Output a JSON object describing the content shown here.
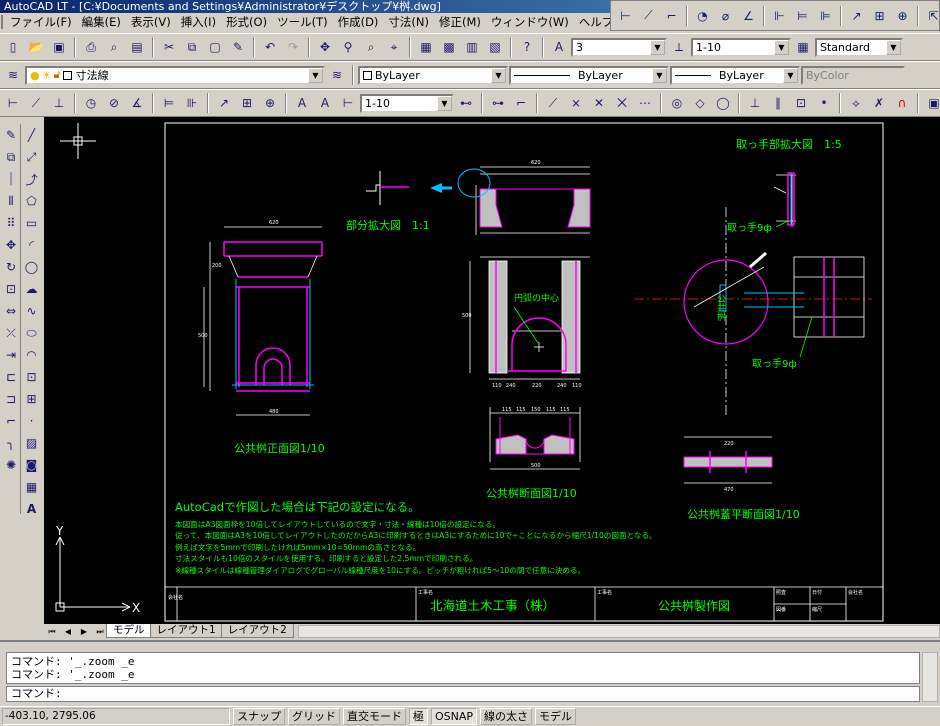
{
  "app": {
    "title": "AutoCAD LT - [C:¥Documents and Settings¥Administrator¥デスクトップ¥桝.dwg]"
  },
  "menu": [
    "ファイル(F)",
    "編集(E)",
    "表示(V)",
    "挿入(I)",
    "形式(O)",
    "ツール(T)",
    "作成(D)",
    "寸法(N)",
    "修正(M)",
    "ウィンドウ(W)",
    "ヘルプ(H)"
  ],
  "toolbar": {
    "text_height": "3",
    "dim_scale": "1-10",
    "text_style": "Standard",
    "layer": "寸法線",
    "color": "ByLayer",
    "linetype": "ByLayer",
    "lineweight": "ByLayer",
    "plotstyle": "ByColor",
    "dim_style": "1-10"
  },
  "drawing": {
    "front_title": "公共桝正面図1/10",
    "section_title": "公共桝断面図1/10",
    "lid_title": "公共桝蓋平断面図1/10",
    "partial_title": "部分拡大図　1:1",
    "handle_title": "取っ手部拡大図　1:5",
    "handle_label": "取っ手9ф",
    "handle_label2": "取っ手9ф",
    "arc_center_label": "円弧の中心",
    "lid_text": "公共桝",
    "notes_heading": "AutoCadで作図した場合は下記の設定になる。",
    "notes": [
      "本図面はA3図面枠を10倍してレイアウトしているので文字・寸法・線種は10倍の設定になる。",
      "従って、本図面はA3を10倍してレイアウトしたのだからA3に印刷するときはA3にするために10で÷ことになるから縮尺1/10の図面となる。",
      "例えば文字を5mmで印刷したければ5mm×10=50mmの高さとなる。",
      "寸法スタイルも10倍のスタイルを使用する。印刷すると設定した2.5mmで印刷される。",
      "※線種スタイルは線種管理ダイアログでグローバル線種尺度を10にする。ピッチが粗ければ5～10の間で任意に決める。"
    ],
    "company": "北海道土木工事（株）",
    "drawing_name": "公共桝製作図",
    "tb_project_label": "工事名",
    "tb_date_label": "日付",
    "tb_scale_label": "縮尺",
    "tb_sheet_label": "図番",
    "tb_check_label": "照査",
    "tb_company_label": "会社名",
    "dims": {
      "front_top": "620",
      "front_bottom": "480",
      "front_h1": "200",
      "front_h2": "500",
      "sec_top": "620",
      "sec_h": "500",
      "sec_b1": "110",
      "sec_b2": "240",
      "sec_b3": "220",
      "sec_b4": "240",
      "sec_b5": "110",
      "btm_w": "500",
      "btm_parts": [
        "115",
        "115",
        "150",
        "115",
        "115"
      ],
      "lid_w": "470",
      "lid_inner": "220"
    },
    "ucs_y": "Y",
    "ucs_x": "X"
  },
  "tabs": [
    "モデル",
    "レイアウト1",
    "レイアウト2"
  ],
  "command": {
    "history": [
      "コマンド: '_.zoom _e",
      "コマンド: '_.zoom _e"
    ],
    "prompt": "コマンド:"
  },
  "status": {
    "coords": "-403.10, 2795.06",
    "buttons": [
      "スナップ",
      "グリッド",
      "直交モード",
      "極",
      "OSNAP",
      "線の太さ",
      "モデル"
    ]
  },
  "colors": {
    "accent_green": "#00ff00",
    "magenta": "#ff00ff",
    "cyan": "#00bfff",
    "red": "#ff2020",
    "yellow": "#ffff00"
  }
}
